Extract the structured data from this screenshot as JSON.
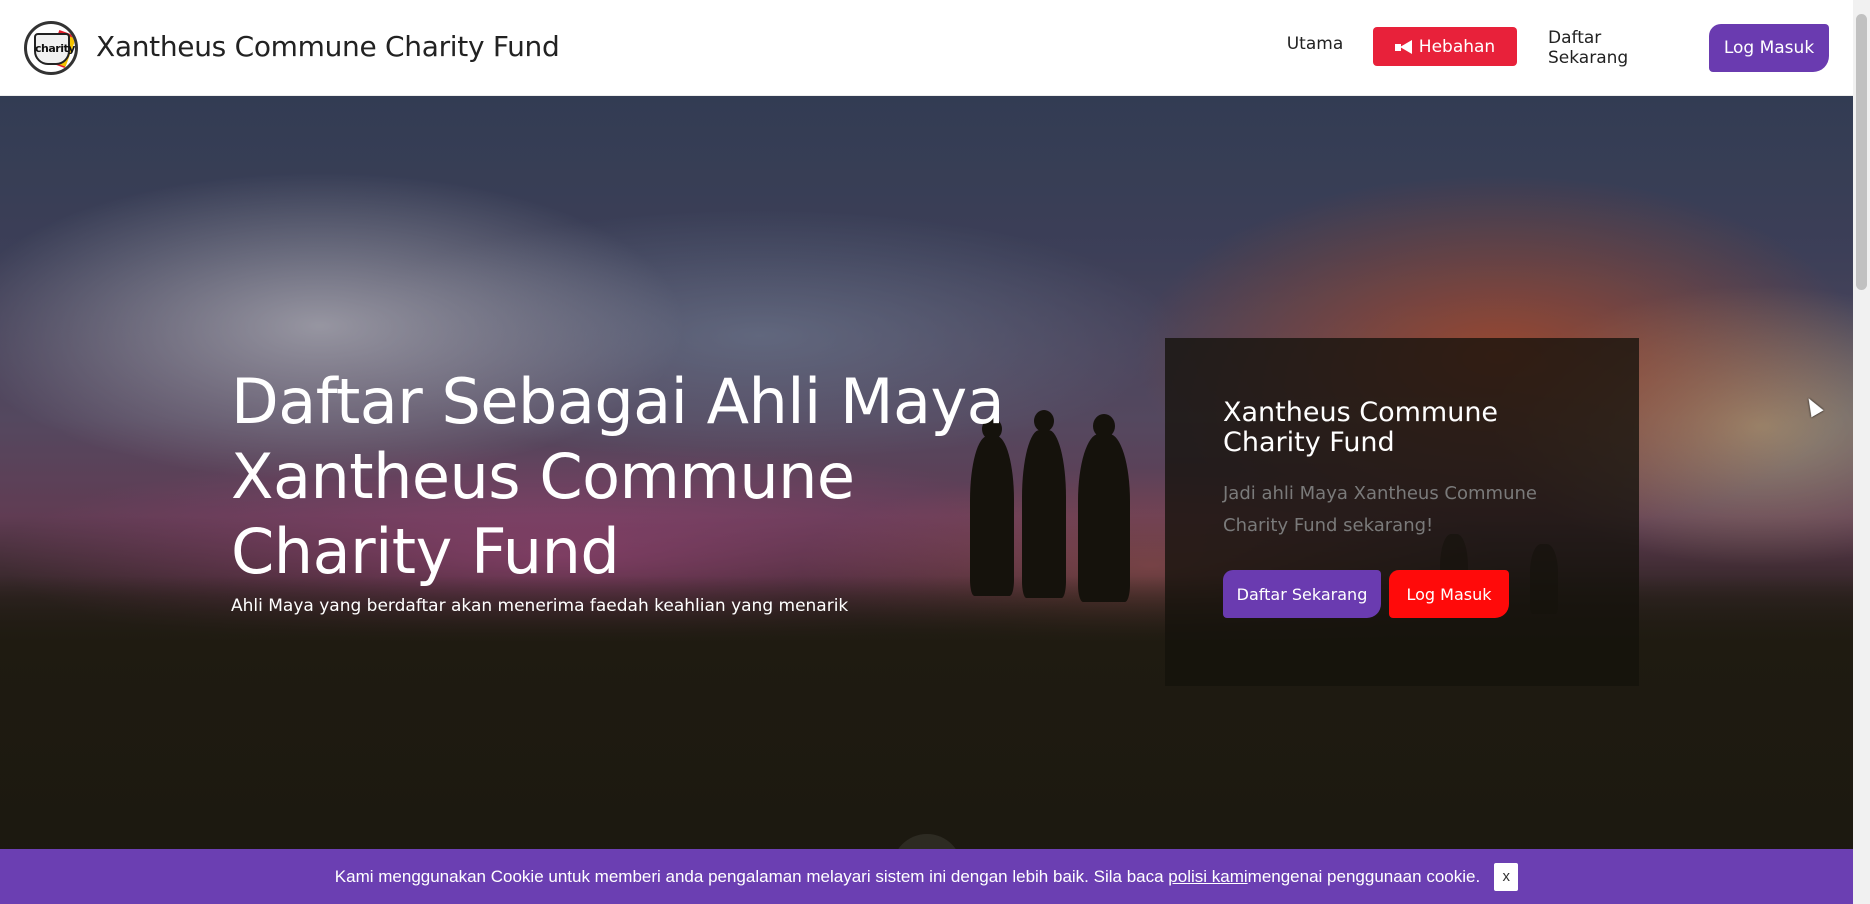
{
  "header": {
    "site_title": "Xantheus Commune Charity Fund",
    "logo_text": "charity",
    "nav": {
      "utama": "Utama",
      "hebahan": "Hebahan",
      "daftar": "Daftar Sekarang",
      "login": "Log Masuk"
    }
  },
  "hero": {
    "title": "Daftar Sebagai Ahli Maya Xantheus Commune Charity Fund",
    "subtitle": "Ahli Maya yang berdaftar akan menerima faedah keahlian yang menarik",
    "panel": {
      "title": "Xantheus Commune Charity Fund",
      "text": "Jadi ahli Maya Xantheus Commune Charity Fund sekarang!",
      "register_button": "Daftar Sekarang",
      "login_button": "Log Masuk"
    }
  },
  "cookie": {
    "text_before": "Kami menggunakan Cookie untuk memberi anda pengalaman melayari sistem ini dengan lebih baik. Sila baca ",
    "link_text": "polisi kami",
    "text_after": " mengenai penggunaan cookie.",
    "close_label": "x"
  },
  "colors": {
    "purple": "#6a3bb0",
    "red": "#e8213a",
    "bright_red": "#ff0a0a"
  },
  "icons": {
    "hebahan_icon": "megaphone-icon"
  }
}
